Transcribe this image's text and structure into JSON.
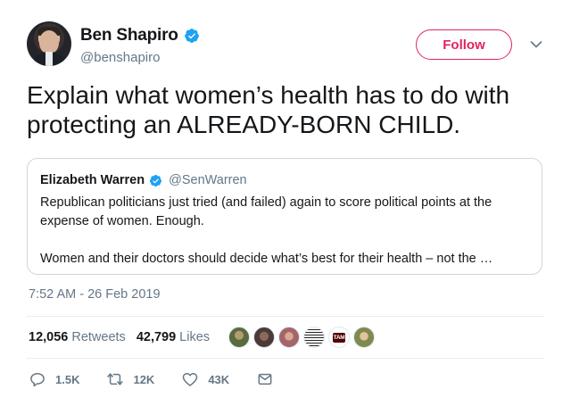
{
  "author": {
    "display_name": "Ben Shapiro",
    "handle": "@benshapiro",
    "verified": true
  },
  "follow_label": "Follow",
  "tweet_text": "Explain what women’s health has to do with protecting an ALREADY-BORN CHILD.",
  "quoted_tweet": {
    "display_name": "Elizabeth Warren",
    "handle": "@SenWarren",
    "verified": true,
    "paragraphs": [
      "Republican politicians just tried (and failed) again to score political points at the expense of women. Enough.",
      "Women and their doctors should decide what’s best for their health – not the …"
    ]
  },
  "timestamp": "7:52 AM - 26 Feb 2019",
  "stats": {
    "retweets_count": "12,056",
    "retweets_label": "Retweets",
    "likes_count": "42,799",
    "likes_label": "Likes"
  },
  "liker_badge_text": "TAM",
  "actions": {
    "replies": "1.5K",
    "retweets": "12K",
    "likes": "43K"
  },
  "colors": {
    "accent": "#e0245e",
    "verified": "#1da1f2",
    "secondary_text": "#657786",
    "border": "#ccd6dd"
  }
}
